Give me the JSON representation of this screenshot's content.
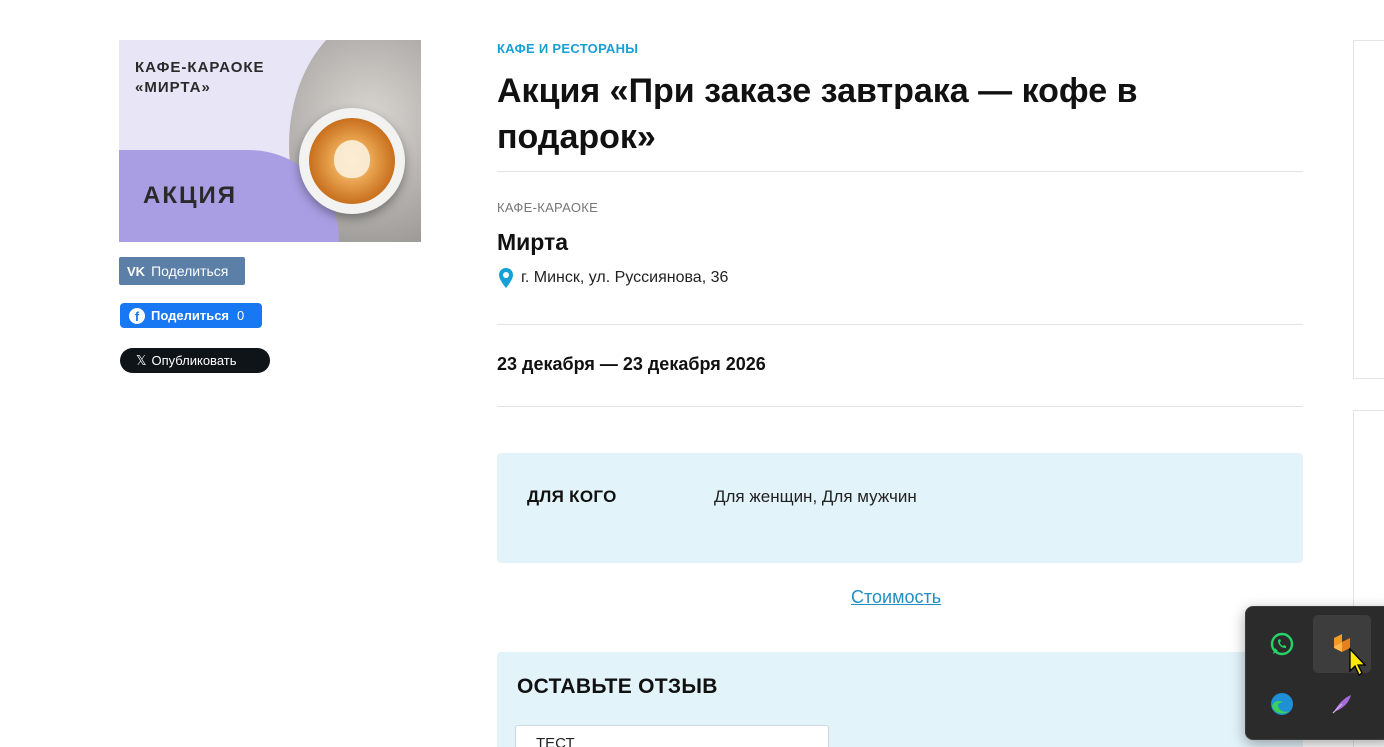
{
  "promo": {
    "venue_caption_line1": "КАФЕ-КАРАОКЕ",
    "venue_caption_line2": "«МИРТА»",
    "badge": "АКЦИЯ"
  },
  "share": {
    "vk_logo": "VK",
    "vk_label": "Поделиться",
    "fb_logo": "f",
    "fb_label": "Поделиться",
    "fb_count": "0",
    "x_logo": "𝕏",
    "x_label": "Опубликовать"
  },
  "event": {
    "category": "КАФЕ И РЕСТОРАНЫ",
    "title": "Акция «При заказе завтрака — кофе в подарок»",
    "place_type": "КАФЕ-КАРАОКЕ",
    "place_name": "Мирта",
    "address": "г. Минск, ул. Руссиянова, 36",
    "dates": "23 декабря — 23 декабря 2026"
  },
  "audience": {
    "label": "ДЛЯ КОГО",
    "value": "Для женщин, Для мужчин"
  },
  "cost_link": "Стоимость",
  "review": {
    "title": "ОСТАВЬТЕ ОТЗЫВ",
    "input_value": "ТЕСТ"
  },
  "tray": {
    "icons": [
      "whatsapp-icon",
      "orange-app-icon",
      "edge-icon",
      "feather-icon"
    ]
  },
  "colors": {
    "accent": "#15a1d6",
    "info_box_bg": "#e3f3fa",
    "vk": "#5b7fa6",
    "facebook": "#1877f2",
    "x": "#0f1419"
  }
}
